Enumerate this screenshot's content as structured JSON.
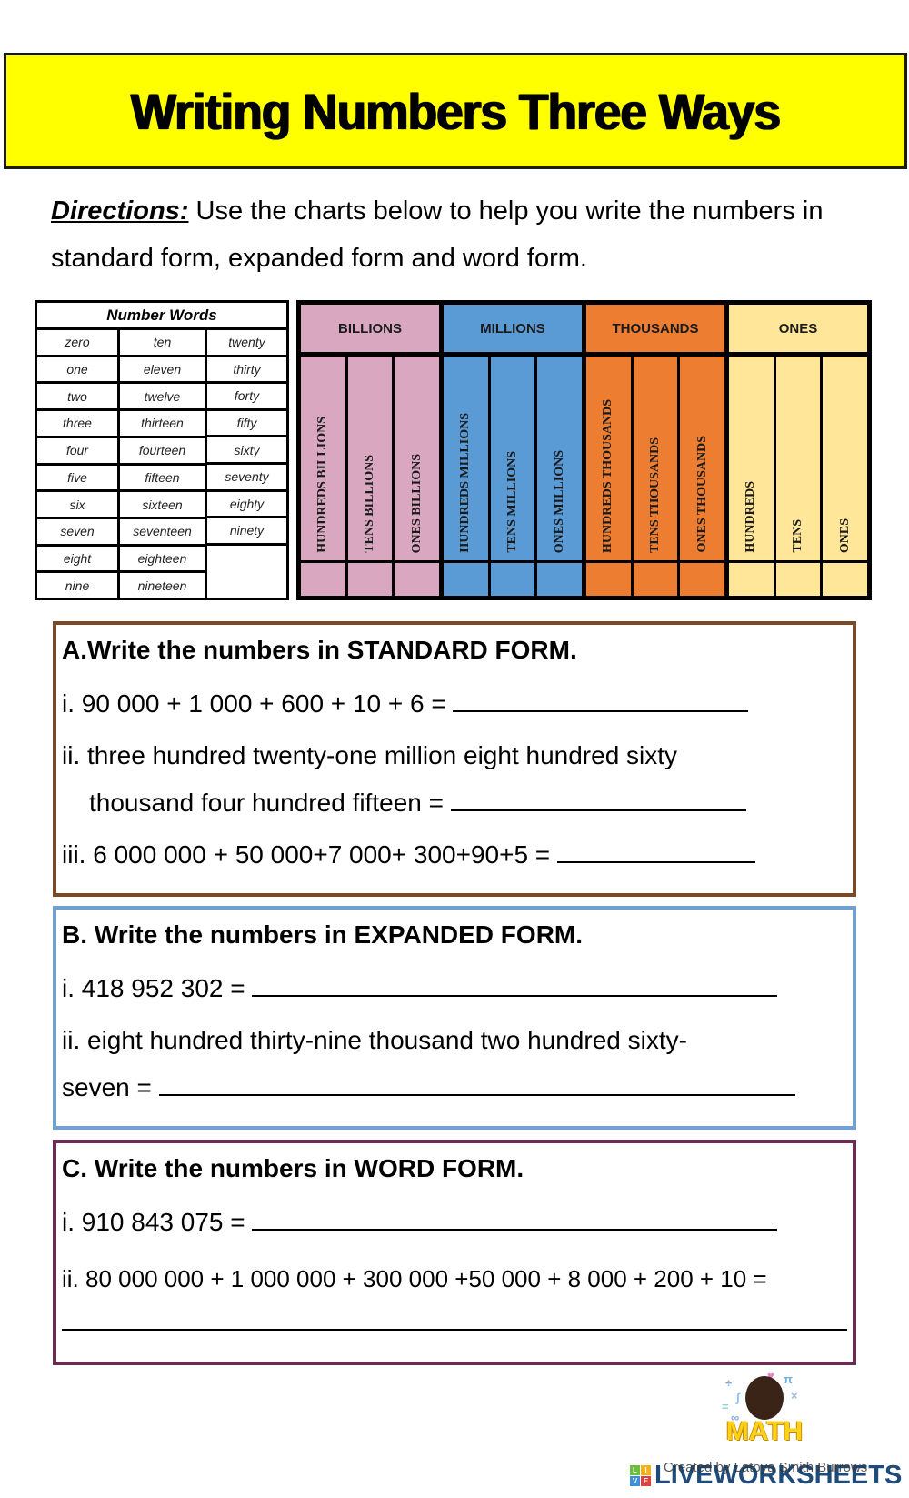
{
  "title": "Writing Numbers Three Ways",
  "colors": {
    "title_bg": "#ffff00",
    "billions": "#d9a8c0",
    "millions": "#5b9bd5",
    "thousands": "#ed7d31",
    "ones": "#ffe699",
    "section_a_border": "#7a4a26",
    "section_b_border": "#6fa0d0",
    "section_c_border": "#6b2c52"
  },
  "directions": {
    "label": "Directions:",
    "text": " Use the charts below to help you write the numbers in standard form, expanded form and word form."
  },
  "number_words": {
    "header": "Number Words",
    "columns": [
      [
        "zero",
        "one",
        "two",
        "three",
        "four",
        "five",
        "six",
        "seven",
        "eight",
        "nine"
      ],
      [
        "ten",
        "eleven",
        "twelve",
        "thirteen",
        "fourteen",
        "fifteen",
        "sixteen",
        "seventeen",
        "eighteen",
        "nineteen"
      ],
      [
        "twenty",
        "thirty",
        "forty",
        "fifty",
        "sixty",
        "seventy",
        "eighty",
        "ninety"
      ]
    ]
  },
  "place_value_chart": {
    "periods": [
      {
        "name": "BILLIONS",
        "color": "#d9a8c0",
        "places": [
          "HUNDREDS BILLIONS",
          "TENS BILLIONS",
          "ONES BILLIONS"
        ]
      },
      {
        "name": "MILLIONS",
        "color": "#5b9bd5",
        "places": [
          "HUNDREDS MILLIONS",
          "TENS MILLIONS",
          "ONES MILLIONS"
        ]
      },
      {
        "name": "THOUSANDS",
        "color": "#ed7d31",
        "places": [
          "HUNDREDS THOUSANDS",
          "TENS THOUSANDS",
          "ONES THOUSANDS"
        ]
      },
      {
        "name": "ONES",
        "color": "#ffe699",
        "places": [
          "HUNDREDS",
          "TENS",
          "ONES"
        ]
      }
    ]
  },
  "sections": {
    "a": {
      "heading": "A.Write the numbers in STANDARD FORM.",
      "q1": "i.  90 000 + 1 000 + 600 + 10 + 6 =",
      "q2_line1": "ii. three hundred twenty-one million eight hundred sixty",
      "q2_line2": "thousand four hundred fifteen =",
      "q3": "iii.  6 000 000 + 50 000+7 000+ 300+90+5 ="
    },
    "b": {
      "heading": "B.  Write the numbers in EXPANDED FORM.",
      "q1": "i.  418 952 302 =",
      "q2_line1": "ii. eight hundred thirty-nine thousand two hundred sixty-",
      "q2_line2": "seven ="
    },
    "c": {
      "heading": "C.  Write the numbers in WORD FORM.",
      "q1": "i.  910 843 075 =",
      "q2": "ii. 80 000 000 + 1 000 000 + 300 000 +50 000 + 8 000 + 200 + 10 ="
    }
  },
  "footer": {
    "math_logo_text": "MATH",
    "math_symbols": [
      "÷",
      "π",
      "∫",
      "×",
      "=",
      "∞",
      "♥"
    ],
    "brand_blocks": [
      "L",
      "I",
      "V",
      "E"
    ],
    "brand_name": "LIVEWORKSHEETS",
    "created_by": "Created by Latoya Smith Burrows"
  }
}
